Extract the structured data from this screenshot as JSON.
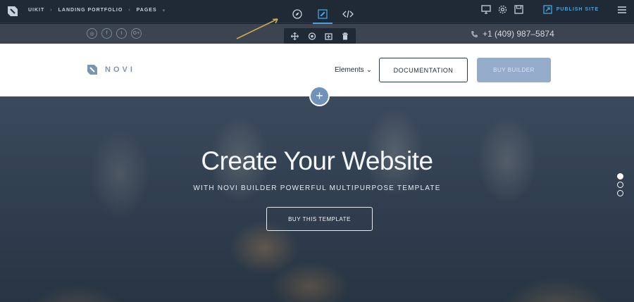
{
  "editor": {
    "breadcrumb": [
      "UIKIT",
      "LANDING PORTFOLIO",
      "PAGES"
    ],
    "publish_label": "PUBLISH SITE",
    "accent": "#4aa3df",
    "center_tools": [
      "compass-icon",
      "edit-icon",
      "code-icon"
    ],
    "right_tools": [
      "monitor-icon",
      "gear-icon",
      "save-icon",
      "publish-icon",
      "menu-icon"
    ]
  },
  "infobar": {
    "socials": [
      "instagram",
      "facebook",
      "twitter",
      "google-plus"
    ],
    "phone": "+1 (409) 987–5874"
  },
  "element_tools": [
    "move-icon",
    "eye-icon",
    "duplicate-icon",
    "trash-icon"
  ],
  "header": {
    "brand": "NOVI",
    "menu_label": "Elements",
    "documentation_label": "DOCUMENTATION",
    "buy_label": "BUY BUILDER",
    "brand_color": "#7d95b3"
  },
  "hero": {
    "title": "Create Your Website",
    "subtitle": "WITH NOVI BUILDER POWERFUL MULTIPURPOSE TEMPLATE",
    "button_label": "BUY THIS TEMPLATE"
  }
}
